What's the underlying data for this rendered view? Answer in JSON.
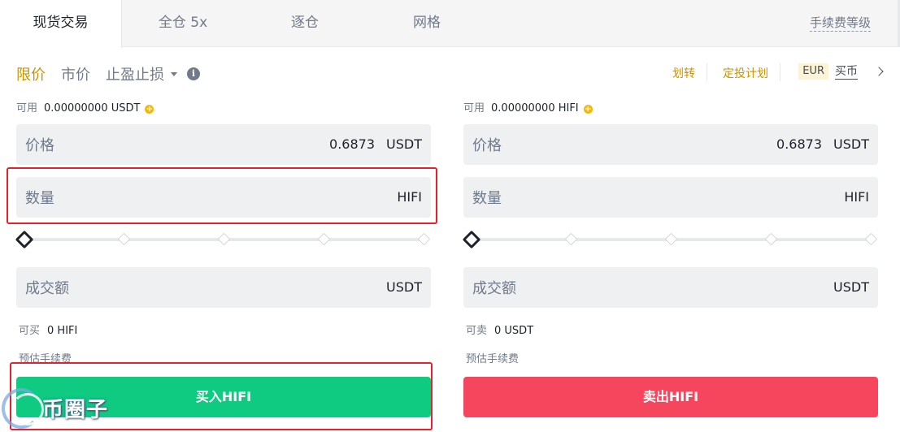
{
  "tabs": {
    "spot": "现货交易",
    "cross": "全仓 5x",
    "isolated": "逐仓",
    "grid": "网格",
    "fee_level": "手续费等级"
  },
  "order_types": {
    "limit": "限价",
    "market": "市价",
    "stop_limit": "止盈止损",
    "info_icon": "i"
  },
  "top_links": {
    "transfer": "划转",
    "dca": "定投计划",
    "currency": "EUR",
    "buy_crypto": "买币"
  },
  "buy_panel": {
    "available_label": "可用",
    "available_value": "0.00000000 USDT",
    "price_label": "价格",
    "price_value": "0.6873",
    "price_unit": "USDT",
    "qty_label": "数量",
    "qty_unit": "HIFI",
    "total_label": "成交额",
    "total_unit": "USDT",
    "can_label": "可买",
    "can_value": "0 HIFI",
    "fee_label": "预估手续费",
    "button": "买入HIFI",
    "slider_percent": 0
  },
  "sell_panel": {
    "available_label": "可用",
    "available_value": "0.00000000 HIFI",
    "price_label": "价格",
    "price_value": "0.6873",
    "price_unit": "USDT",
    "qty_label": "数量",
    "qty_unit": "HIFI",
    "total_label": "成交额",
    "total_unit": "USDT",
    "can_label": "可卖",
    "can_value": "0 USDT",
    "fee_label": "预估手续费",
    "button": "卖出HIFI",
    "slider_percent": 0
  },
  "watermark": {
    "text": "币圈子"
  },
  "colors": {
    "accent": "#c99400",
    "buy": "#0ecb81",
    "sell": "#f6465d",
    "annotation": "#e8202a"
  }
}
